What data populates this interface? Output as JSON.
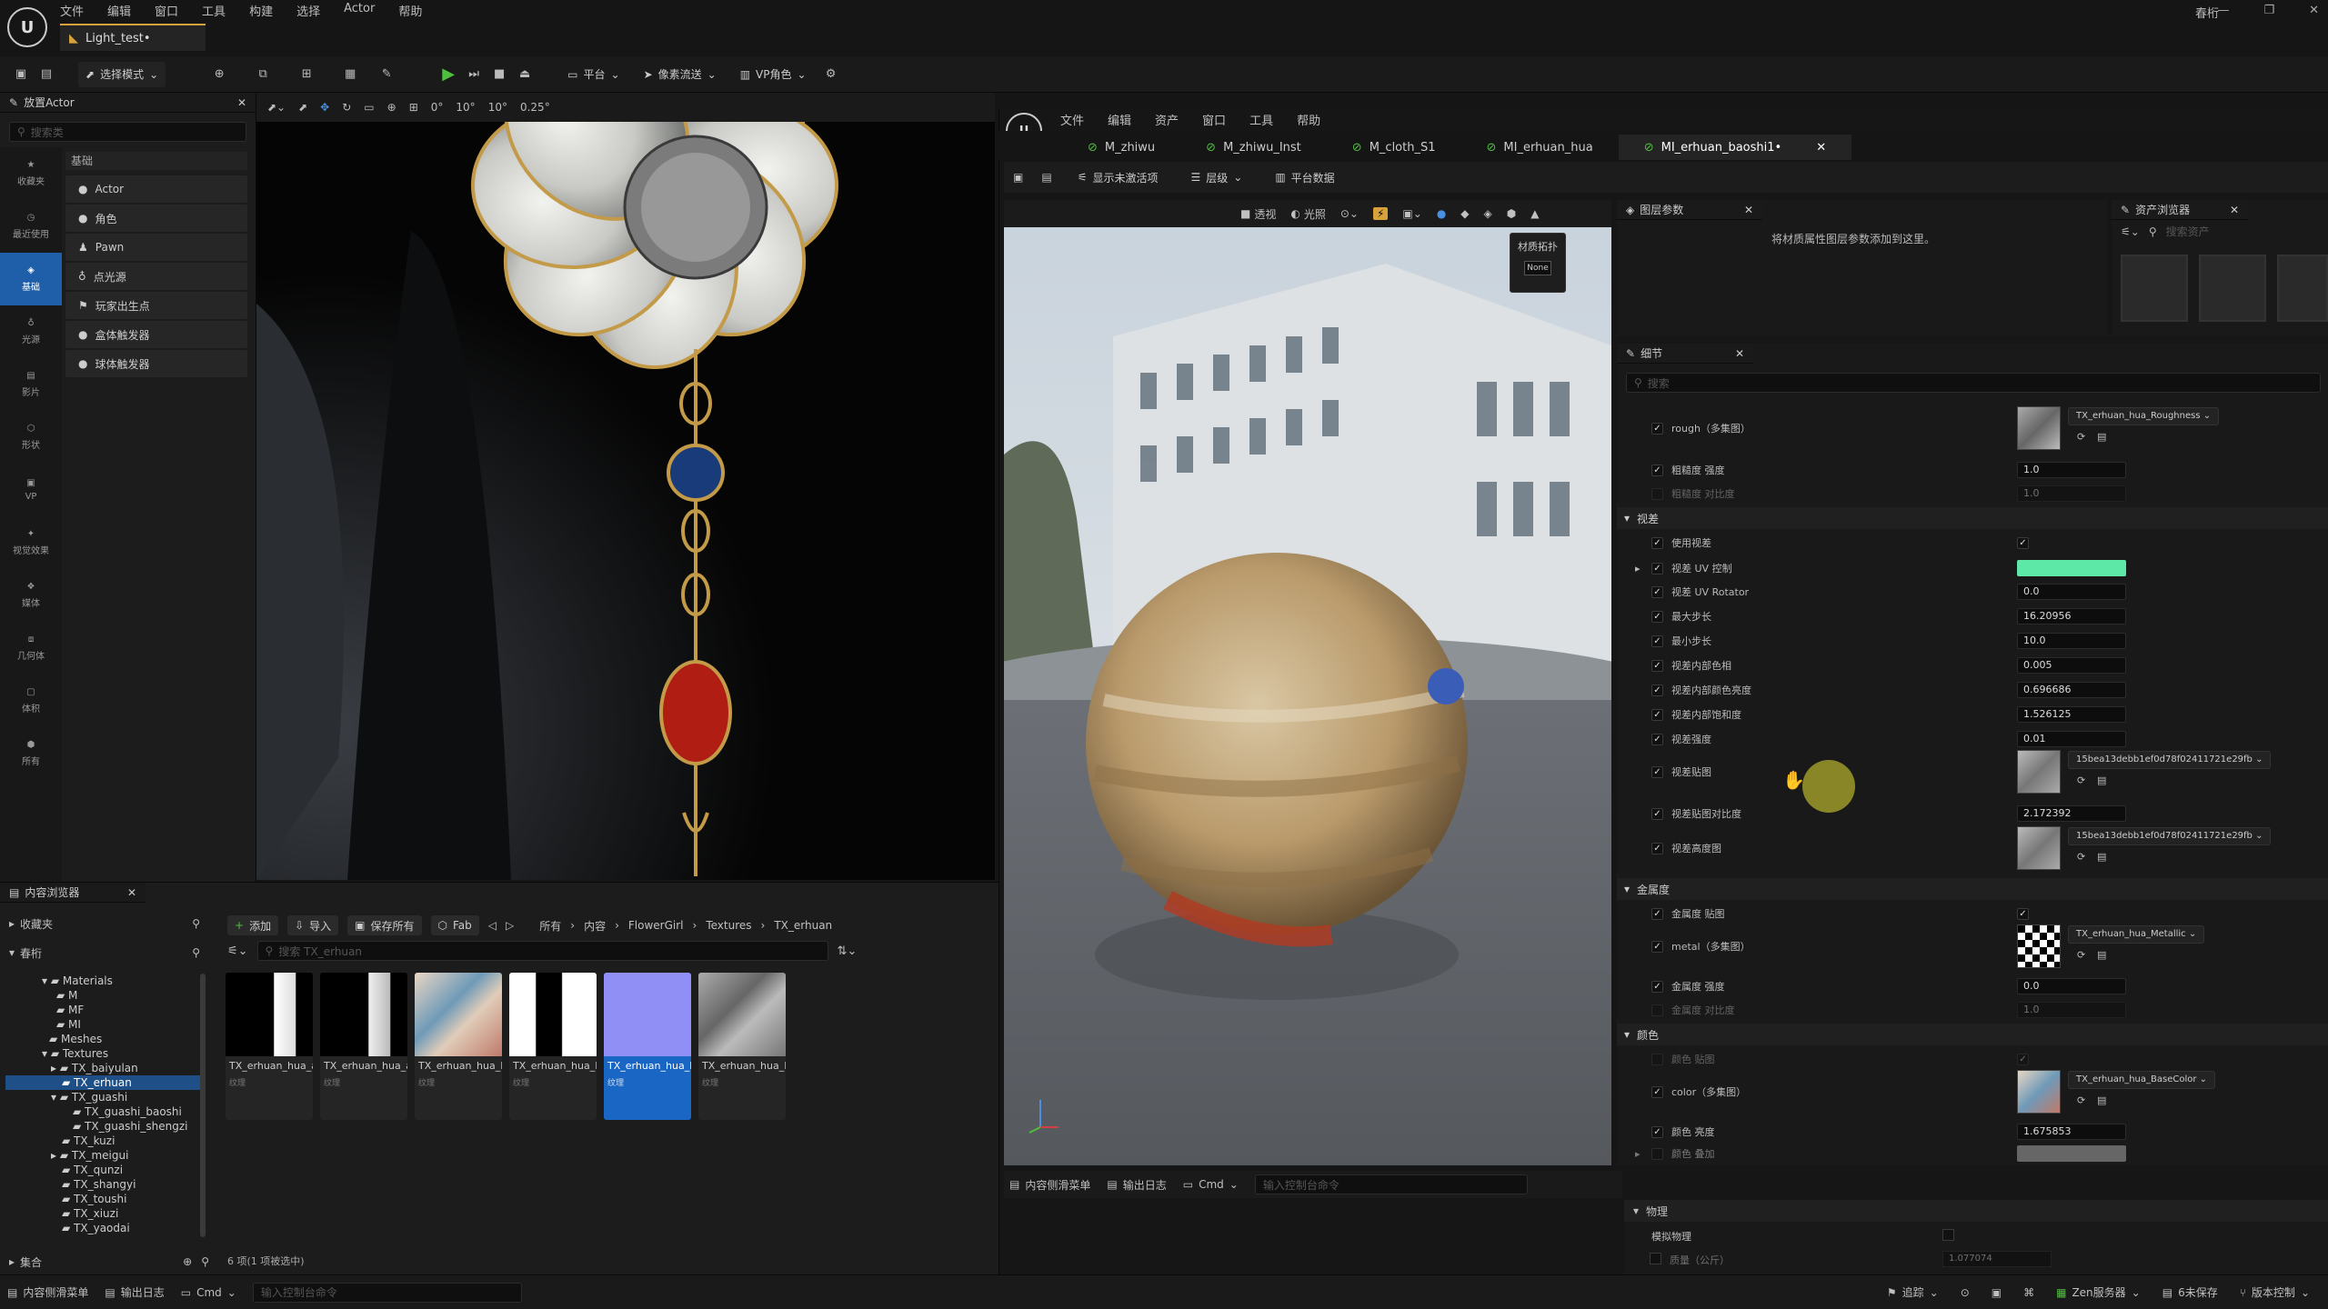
{
  "menu": {
    "file": "文件",
    "edit": "编辑",
    "window": "窗口",
    "tools": "工具",
    "build": "构建",
    "select": "选择",
    "actor": "Actor",
    "help": "帮助"
  },
  "level_tab": "Light_test•",
  "user": "春桁",
  "toolbar": {
    "select_mode": "选择模式",
    "platform": "平台",
    "pixel_stream": "像素流送",
    "vp_role": "VP角色"
  },
  "place_actor": {
    "title": "放置Actor",
    "search": "搜索类",
    "section": "基础",
    "items": [
      "Actor",
      "角色",
      "Pawn",
      "点光源",
      "玩家出生点",
      "盒体触发器",
      "球体触发器"
    ],
    "categories": [
      "收藏夹",
      "最近使用",
      "基础",
      "光源",
      "影片",
      "形状",
      "VP",
      "视觉效果",
      "媒体",
      "几何体",
      "体积",
      "所有"
    ]
  },
  "vp_toolbar": {
    "v1": "0°",
    "v2": "10°",
    "v3": "10°",
    "v4": "0.25°"
  },
  "content_browser": {
    "title": "内容浏览器",
    "favorites": "收藏夹",
    "project": "春桁",
    "add": "添加",
    "import": "导入",
    "save_all": "保存所有",
    "fab": "Fab",
    "breadcrumb": [
      "所有",
      "内容",
      "FlowerGirl",
      "Textures",
      "TX_erhuan"
    ],
    "search": "搜索 TX_erhuan",
    "tree": [
      "Materials",
      "M",
      "MF",
      "MI",
      "Meshes",
      "Textures",
      "TX_baiyulan",
      "TX_erhuan",
      "TX_guashi",
      "TX_guashi_baoshi",
      "TX_guashi_shengzi",
      "TX_kuzi",
      "TX_meigui",
      "TX_qunzi",
      "TX_shangyi",
      "TX_toushi",
      "TX_xiuzi",
      "TX_yaodai"
    ],
    "collections": "集合",
    "assets": [
      {
        "name": "TX_erhuan_hua_aniso_A",
        "type": "纹理"
      },
      {
        "name": "TX_erhuan_hua_aniso_L",
        "type": "纹理"
      },
      {
        "name": "TX_erhuan_hua_BaseColor",
        "type": "纹理"
      },
      {
        "name": "TX_erhuan_hua_Metallic",
        "type": "纹理"
      },
      {
        "name": "TX_erhuan_hua_Normal",
        "type": "纹理"
      },
      {
        "name": "TX_erhuan_hua_Roughness",
        "type": "纹理"
      }
    ],
    "status": "6 项(1 项被选中)"
  },
  "mat_editor": {
    "menu": [
      "文件",
      "编辑",
      "资产",
      "窗口",
      "工具",
      "帮助"
    ],
    "tabs": [
      "M_zhiwu",
      "M_zhiwu_Inst",
      "M_cloth_S1",
      "MI_erhuan_hua",
      "MI_erhuan_baoshi1•"
    ],
    "toolbar": {
      "show_inactive": "显示未激活项",
      "hierarchy": "层级",
      "platform_stats": "平台数据"
    },
    "viewport": {
      "perspective": "透视",
      "lit": "光照",
      "mat_topology": "材质拓扑",
      "none": "None"
    },
    "layer_params": {
      "title": "图层参数",
      "hint": "将材质属性图层参数添加到这里。"
    },
    "asset_browser": {
      "title": "资产浏览器",
      "search": "搜索资产"
    },
    "details": {
      "title": "细节",
      "search": "搜索"
    }
  },
  "details_rows": [
    {
      "label": "rough（多集图）",
      "value": "TX_erhuan_hua_Roughness"
    },
    {
      "label": "粗糙度 强度",
      "value": "1.0"
    },
    {
      "label": "粗糙度 对比度",
      "value": "1.0"
    },
    {
      "label": "视差"
    },
    {
      "label": "使用视差"
    },
    {
      "label": "视差 UV 控制"
    },
    {
      "label": "视差 UV Rotator",
      "value": "0.0"
    },
    {
      "label": "最大步长",
      "value": "16.20956"
    },
    {
      "label": "最小步长",
      "value": "10.0"
    },
    {
      "label": "视差内部色相",
      "value": "0.005"
    },
    {
      "label": "视差内部颜色亮度",
      "value": "0.696686"
    },
    {
      "label": "视差内部饱和度",
      "value": "1.526125"
    },
    {
      "label": "视差强度",
      "value": "0.01"
    },
    {
      "label": "视差贴图",
      "value": "15bea13debb1ef0d78f02411721e29fb"
    },
    {
      "label": "视差贴图对比度",
      "value": "2.172392"
    },
    {
      "label": "视差高度图",
      "value": "15bea13debb1ef0d78f02411721e29fb"
    },
    {
      "label": "金属度"
    },
    {
      "label": "金属度 贴图"
    },
    {
      "label": "metal（多集图）",
      "value": "TX_erhuan_hua_Metallic"
    },
    {
      "label": "金属度 强度",
      "value": "0.0"
    },
    {
      "label": "金属度 对比度",
      "value": "1.0"
    },
    {
      "label": "颜色"
    },
    {
      "label": "颜色 贴图"
    },
    {
      "label": "color（多集图）",
      "value": "TX_erhuan_hua_BaseColor"
    },
    {
      "label": "颜色 亮度",
      "value": "1.675853"
    },
    {
      "label": "颜色 叠加"
    }
  ],
  "physics": {
    "title": "物理",
    "simulate": "模拟物理",
    "mass": "质量（公斤）",
    "mass_value": "1.077074"
  },
  "bottom": {
    "content_drawer": "内容侧滑菜单",
    "output_log": "输出日志",
    "cmd": "Cmd",
    "console": "输入控制台命令",
    "trace": "追踪",
    "zen": "Zen服务器",
    "unsaved": "6未保存",
    "version": "版本控制"
  },
  "colors": {
    "accent": "#1f5ea8",
    "selected_asset": "#1a66c4",
    "level_tab": "#d7a23a",
    "parallax_uv": "#5de8a8",
    "cursor": "#9c9a2a"
  }
}
